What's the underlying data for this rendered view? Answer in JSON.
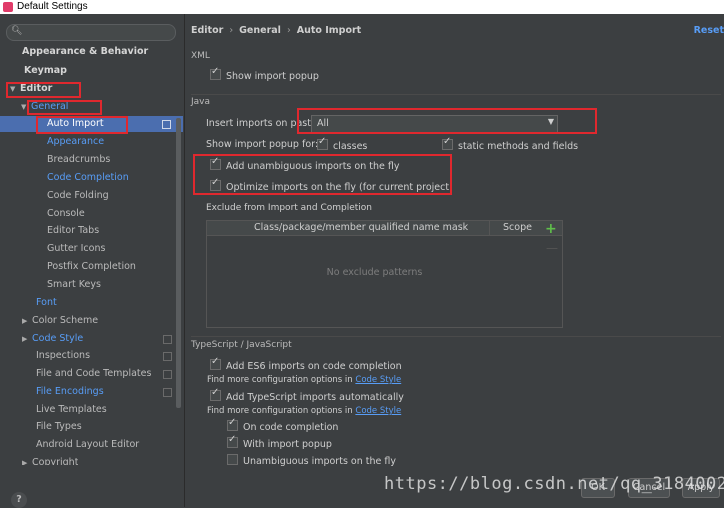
{
  "window": {
    "title": "Default Settings"
  },
  "sidebar": {
    "search_placeholder": "",
    "items": [
      {
        "label": "Appearance & Behavior"
      },
      {
        "label": "Keymap"
      },
      {
        "label": "Editor"
      },
      {
        "label": "General"
      },
      {
        "label": "Auto Import"
      },
      {
        "label": "Appearance"
      },
      {
        "label": "Breadcrumbs"
      },
      {
        "label": "Code Completion"
      },
      {
        "label": "Code Folding"
      },
      {
        "label": "Console"
      },
      {
        "label": "Editor Tabs"
      },
      {
        "label": "Gutter Icons"
      },
      {
        "label": "Postfix Completion"
      },
      {
        "label": "Smart Keys"
      },
      {
        "label": "Font"
      },
      {
        "label": "Color Scheme"
      },
      {
        "label": "Code Style"
      },
      {
        "label": "Inspections"
      },
      {
        "label": "File and Code Templates"
      },
      {
        "label": "File Encodings"
      },
      {
        "label": "Live Templates"
      },
      {
        "label": "File Types"
      },
      {
        "label": "Android Layout Editor"
      },
      {
        "label": "Copyright"
      }
    ],
    "help_label": "?"
  },
  "main": {
    "breadcrumb": [
      "Editor",
      "General",
      "Auto Import"
    ],
    "reset_label": "Reset",
    "xml": {
      "header": "XML",
      "show_import_popup": "Show import popup"
    },
    "java": {
      "header": "Java",
      "insert_imports_label": "Insert imports on paste:",
      "insert_imports_value": "All",
      "show_popup_for": "Show import popup for:",
      "classes": "classes",
      "static_methods": "static methods and fields",
      "add_unambiguous": "Add unambiguous imports on the fly",
      "optimize_imports": "Optimize imports on the fly (for current project)",
      "exclude_header": "Exclude from Import and Completion",
      "table_col1": "Class/package/member qualified name mask",
      "table_col2": "Scope",
      "table_empty": "No exclude patterns",
      "add_icon": "+",
      "remove_icon": "—"
    },
    "ts": {
      "header": "TypeScript / JavaScript",
      "es6": "Add ES6 imports on code completion",
      "more_config_1": "Find more configuration options in",
      "code_style_link_1": "Code Style",
      "ts_imports": "Add TypeScript imports automatically",
      "more_config_2": "Find more configuration options in",
      "code_style_link_2": "Code Style",
      "on_code_completion": "On code completion",
      "with_import_popup": "With import popup",
      "unambiguous": "Unambiguous imports on the fly"
    }
  },
  "footer": {
    "ok": "OK",
    "cancel": "Cancel",
    "apply": "Apply",
    "watermark": "https://blog.csdn.net/qq_31840023"
  },
  "colors": {
    "accent": "#589df6",
    "selection": "#4b6eaf",
    "highlight": "#e0282e"
  }
}
